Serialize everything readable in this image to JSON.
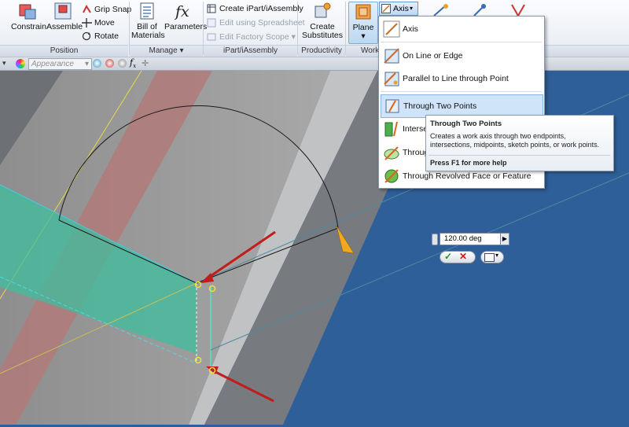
{
  "ribbon": {
    "position_panel": {
      "label": "Position",
      "constrain": "Constrain",
      "assemble": "Assemble",
      "grip_snap": "Grip Snap",
      "move": "Move",
      "rotate": "Rotate"
    },
    "manage_panel": {
      "label": "Manage ▾",
      "bom_line1": "Bill of",
      "bom_line2": "Materials",
      "parameters": "Parameters"
    },
    "ipart_panel": {
      "label": "iPart/iAssembly",
      "create": "Create iPart/iAssembly",
      "edit_spreadsheet": "Edit using Spreadsheet",
      "edit_factory": "Edit Factory Scope ▾"
    },
    "productivity_panel": {
      "label": "Productivity",
      "create_line1": "Create",
      "create_line2": "Substitutes"
    },
    "work_panel": {
      "label": "Work",
      "plane": "Plane",
      "axis": "Axis"
    }
  },
  "toolbar": {
    "appearance_placeholder": "Appearance"
  },
  "axis_menu": {
    "items": [
      {
        "label": "Axis",
        "icon": "axis-icon"
      },
      {
        "label": "On Line or Edge",
        "icon": "axis-on-line-icon"
      },
      {
        "label": "Parallel to Line  through Point",
        "icon": "axis-parallel-icon"
      },
      {
        "label": "Through Two Points",
        "icon": "axis-two-points-icon",
        "highlighted": true
      },
      {
        "label": "Intersec",
        "icon": "axis-intersection-icon"
      },
      {
        "label": "Through",
        "icon": "axis-normal-icon"
      },
      {
        "label": "Through Revolved Face or Feature",
        "icon": "axis-revolved-icon"
      }
    ]
  },
  "tooltip": {
    "title": "Through Two Points",
    "description": "Creates a work axis through two endpoints, intersections, midpoints, sketch points, or work points.",
    "help": "Press F1 for more help"
  },
  "minitoolbar": {
    "angle_value": "120.00 deg"
  },
  "colors": {
    "background": "#2f5f98",
    "highlight": "#cfe4f8",
    "preview_green": "#36b89a",
    "red_arrow": "#cc1f1f",
    "orange_arrow": "#e0a020"
  }
}
